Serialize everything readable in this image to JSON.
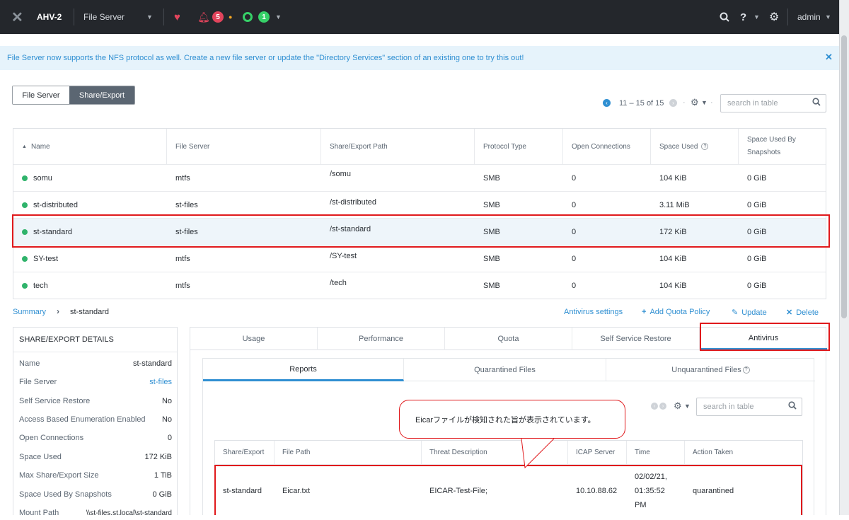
{
  "topbar": {
    "cluster_name": "AHV-2",
    "menu_label": "File Server",
    "alert_count": "5",
    "task_count": "1",
    "user": "admin"
  },
  "banner": {
    "message": "File Server now supports the NFS protocol as well. Create a new file server or update the \"Directory Services\" section of an existing one to try this out!"
  },
  "view_toggle": {
    "option1": "File Server",
    "option2": "Share/Export",
    "selected": "Share/Export"
  },
  "pagination": {
    "range": "11 – 15 of 15"
  },
  "table_search": {
    "placeholder": "search in table"
  },
  "shares_table": {
    "columns": [
      "Name",
      "File Server",
      "Share/Export Path",
      "Protocol Type",
      "Open Connections",
      "Space Used",
      "Space Used By Snapshots"
    ],
    "rows": [
      {
        "name": "somu",
        "file_server": "mtfs",
        "path": "/somu",
        "protocol": "SMB",
        "open": "0",
        "used": "104 KiB",
        "snap": "0 GiB"
      },
      {
        "name": "st-distributed",
        "file_server": "st-files",
        "path": "/st-distributed",
        "protocol": "SMB",
        "open": "0",
        "used": "3.11 MiB",
        "snap": "0 GiB"
      },
      {
        "name": "st-standard",
        "file_server": "st-files",
        "path": "/st-standard",
        "protocol": "SMB",
        "open": "0",
        "used": "172 KiB",
        "snap": "0 GiB"
      },
      {
        "name": "SY-test",
        "file_server": "mtfs",
        "path": "/SY-test",
        "protocol": "SMB",
        "open": "0",
        "used": "104 KiB",
        "snap": "0 GiB"
      },
      {
        "name": "tech",
        "file_server": "mtfs",
        "path": "/tech",
        "protocol": "SMB",
        "open": "0",
        "used": "104 KiB",
        "snap": "0 GiB"
      }
    ],
    "selected_row": "st-standard"
  },
  "breadcrumb": {
    "root": "Summary",
    "current": "st-standard"
  },
  "actions": {
    "antivirus_settings": "Antivirus settings",
    "add_quota": "Add Quota Policy",
    "update": "Update",
    "delete": "Delete"
  },
  "details": {
    "title": "SHARE/EXPORT DETAILS",
    "rows": [
      {
        "k": "Name",
        "v": "st-standard"
      },
      {
        "k": "File Server",
        "v": "st-files"
      },
      {
        "k": "Self Service Restore",
        "v": "No"
      },
      {
        "k": "Access Based Enumeration Enabled",
        "v": "No"
      },
      {
        "k": "Open Connections",
        "v": "0"
      },
      {
        "k": "Space Used",
        "v": "172 KiB"
      },
      {
        "k": "Max Share/Export Size",
        "v": "1 TiB"
      },
      {
        "k": "Space Used By Snapshots",
        "v": "0 GiB"
      },
      {
        "k": "Mount Path",
        "v": "\\\\st-files.st.local\\st-standard"
      }
    ]
  },
  "tabs": [
    "Usage",
    "Performance",
    "Quota",
    "Self Service Restore",
    "Antivirus"
  ],
  "active_tab": "Antivirus",
  "subtabs": [
    "Reports",
    "Quarantined Files",
    "Unquarantined Files"
  ],
  "active_subtab": "Reports",
  "report_search": {
    "placeholder": "search in table"
  },
  "callout": {
    "text": "Eicarファイルが検知された旨が表示されています。"
  },
  "report_table": {
    "columns": [
      "Share/Export",
      "File Path",
      "Threat Description",
      "ICAP Server",
      "Time",
      "Action Taken"
    ],
    "rows": [
      {
        "share": "st-standard",
        "file": "Eicar.txt",
        "threat": "EICAR-Test-File;",
        "icap": "10.10.88.62",
        "time": "02/02/21,\n01:35:52\nPM",
        "action": "quarantined"
      }
    ]
  },
  "colors": {
    "accent": "#2f8fd2",
    "highlight": "#e0191c",
    "status_ok": "#2fb36b",
    "topbar": "#24272c"
  }
}
